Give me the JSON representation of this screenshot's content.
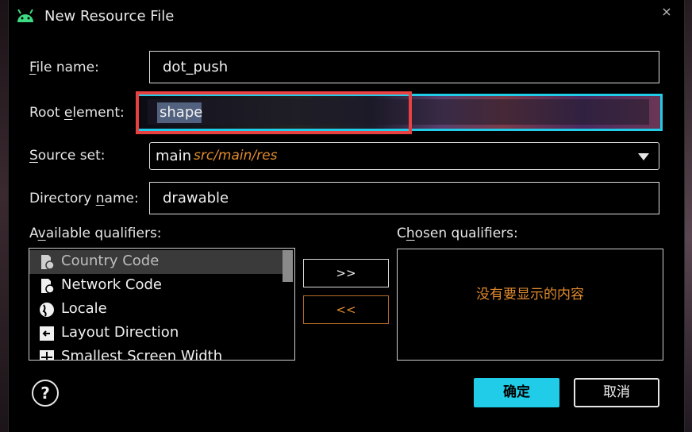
{
  "window": {
    "title": "New Resource File",
    "close_symbol": "×"
  },
  "form": {
    "file_name": {
      "label_u": "F",
      "label_rest": "ile name:",
      "value": "dot_push"
    },
    "root_element": {
      "label_a": "Root ",
      "label_u": "e",
      "label_b": "lement:",
      "value": "shape"
    },
    "source_set": {
      "label_u": "S",
      "label_rest": "ource set:",
      "value_main": "main",
      "value_path": "src/main/res"
    },
    "directory_name": {
      "label_a": "Directory ",
      "label_u": "n",
      "label_b": "ame:",
      "value": "drawable"
    }
  },
  "qualifiers": {
    "available_label_a": "A",
    "available_label_u": "v",
    "available_label_b": "ailable qualifiers:",
    "chosen_label_a": "C",
    "chosen_label_u": "h",
    "chosen_label_b": "osen qualifiers:",
    "available": [
      {
        "label": "Country Code",
        "icon": "country-code-icon"
      },
      {
        "label": "Network Code",
        "icon": "network-code-icon"
      },
      {
        "label": "Locale",
        "icon": "globe-icon"
      },
      {
        "label": "Layout Direction",
        "icon": "layout-direction-icon"
      },
      {
        "label": "Smallest Screen Width",
        "icon": "screen-width-icon"
      }
    ],
    "add_button": ">>",
    "remove_button": "<<",
    "chosen_empty": "没有要显示的内容"
  },
  "buttons": {
    "ok": "确定",
    "cancel": "取消",
    "help": "?"
  },
  "colors": {
    "accent": "#21cce8",
    "highlight_red": "#e94141",
    "orange_text": "#e08a2e"
  }
}
